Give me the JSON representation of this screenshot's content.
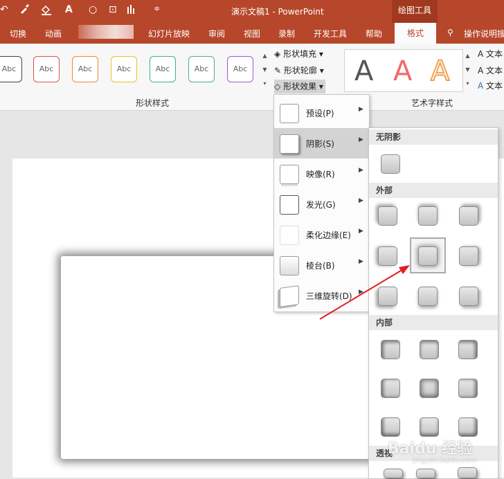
{
  "app": {
    "document_title": "演示文稿1  -  PowerPoint",
    "context_tab_group": "绘图工具"
  },
  "quick_access": {
    "icons": [
      "undo-icon",
      "eyedropper-icon",
      "fill-color-icon",
      "font-color-icon",
      "circle-icon",
      "crop-icon",
      "chart-icon",
      "customize-icon"
    ]
  },
  "ribbon_tabs": [
    "切换",
    "动画",
    "幻灯片放映",
    "审阅",
    "视图",
    "录制",
    "开发工具",
    "帮助",
    "格式",
    "操作说明搜"
  ],
  "ribbon": {
    "shape_styles": {
      "sample_text": "Abc",
      "colors": [
        "#444444",
        "#d9534f",
        "#e8883a",
        "#e6c229",
        "#3bb08f",
        "#4aa9a3",
        "#9b59d0"
      ],
      "group_label": "形状样式"
    },
    "commands": {
      "shape_fill": "形状填充",
      "shape_outline": "形状轮廓",
      "shape_effects": "形状效果"
    },
    "wordart": {
      "letter": "A",
      "group_label": "艺术字样式",
      "cmd1": "文本",
      "cmd2": "文本",
      "cmd3": "文本"
    }
  },
  "effects_menu": {
    "items": [
      {
        "label": "预设(P)",
        "icon": "preset-icon"
      },
      {
        "label": "阴影(S)",
        "icon": "shadow-icon",
        "active": true
      },
      {
        "label": "映像(R)",
        "icon": "reflection-icon"
      },
      {
        "label": "发光(G)",
        "icon": "glow-icon"
      },
      {
        "label": "柔化边缘(E)",
        "icon": "soft-edges-icon"
      },
      {
        "label": "棱台(B)",
        "icon": "bevel-icon"
      },
      {
        "label": "三维旋转(D)",
        "icon": "3d-rotation-icon"
      }
    ]
  },
  "shadow_submenu": {
    "sections": {
      "none": "无阴影",
      "outer": "外部",
      "inner": "内部",
      "perspective": "透视"
    },
    "selected": "外部 - 居中偏移"
  },
  "watermark": {
    "text": "Baidu 经验",
    "sub": "jingyan.baidu.com"
  },
  "colors": {
    "accent": "#b7472a",
    "annotation_arrow": "#e02020"
  }
}
